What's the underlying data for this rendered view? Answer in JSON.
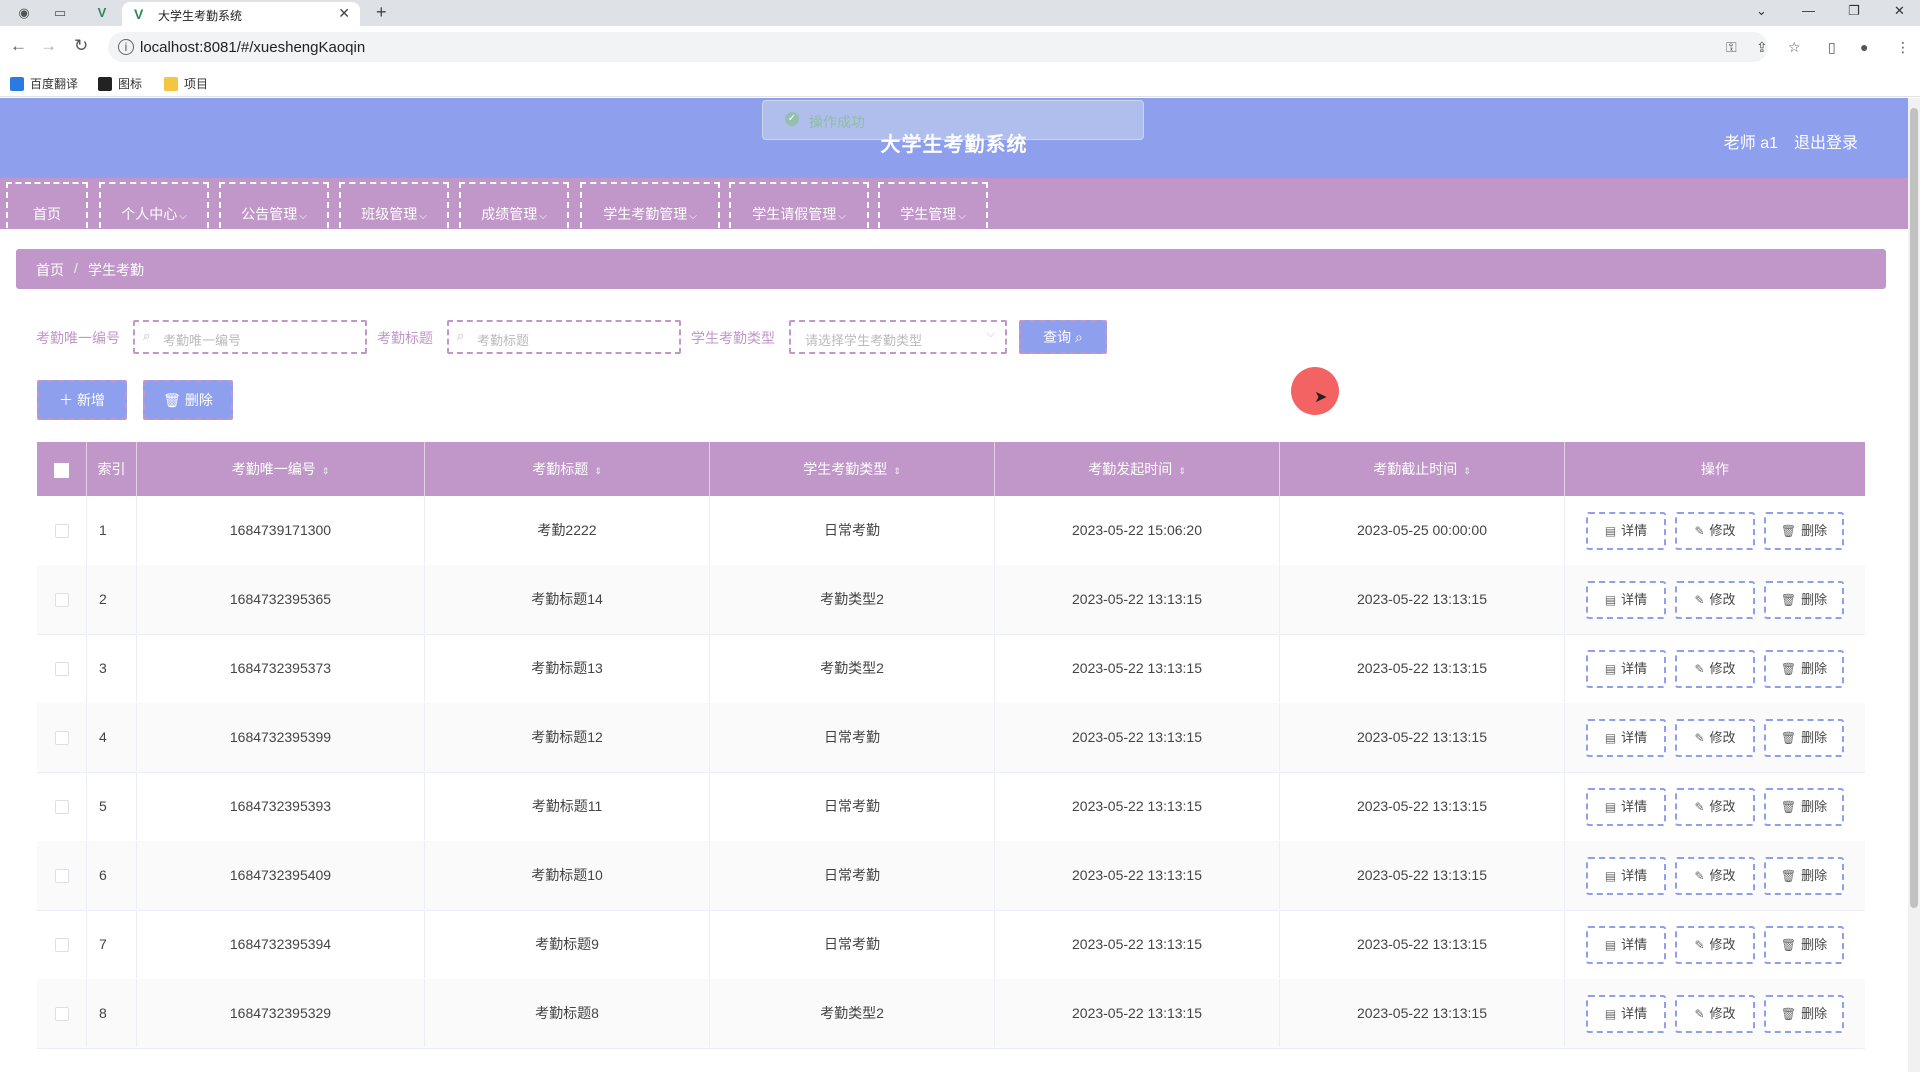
{
  "browser": {
    "tab_title": "大学生考勤系统",
    "url": "localhost:8081/#/xueshengKaoqin",
    "bookmarks": [
      "百度翻译",
      "图标",
      "项目"
    ]
  },
  "header": {
    "title": "大学生考勤系统",
    "user": "老师 a1",
    "logout": "退出登录",
    "toast": "操作成功"
  },
  "menu": [
    "首页",
    "个人中心",
    "公告管理",
    "班级管理",
    "成绩管理",
    "学生考勤管理",
    "学生请假管理",
    "学生管理"
  ],
  "breadcrumb": {
    "home": "首页",
    "sep": "/",
    "current": "学生考勤"
  },
  "search": {
    "id_label": "考勤唯一编号",
    "id_placeholder": "考勤唯一编号",
    "title_label": "考勤标题",
    "title_placeholder": "考勤标题",
    "type_label": "学生考勤类型",
    "type_placeholder": "请选择学生考勤类型",
    "query_button": "查询"
  },
  "actions": {
    "add": "新增",
    "delete": "删除"
  },
  "table": {
    "headers": [
      "索引",
      "考勤唯一编号",
      "考勤标题",
      "学生考勤类型",
      "考勤发起时间",
      "考勤截止时间",
      "操作"
    ],
    "op_labels": {
      "detail": "详情",
      "edit": "修改",
      "delete": "删除"
    },
    "rows": [
      {
        "index": "1",
        "id": "1684739171300",
        "title": "考勤2222",
        "type": "日常考勤",
        "start": "2023-05-22 15:06:20",
        "end": "2023-05-25 00:00:00"
      },
      {
        "index": "2",
        "id": "1684732395365",
        "title": "考勤标题14",
        "type": "考勤类型2",
        "start": "2023-05-22 13:13:15",
        "end": "2023-05-22 13:13:15"
      },
      {
        "index": "3",
        "id": "1684732395373",
        "title": "考勤标题13",
        "type": "考勤类型2",
        "start": "2023-05-22 13:13:15",
        "end": "2023-05-22 13:13:15"
      },
      {
        "index": "4",
        "id": "1684732395399",
        "title": "考勤标题12",
        "type": "日常考勤",
        "start": "2023-05-22 13:13:15",
        "end": "2023-05-22 13:13:15"
      },
      {
        "index": "5",
        "id": "1684732395393",
        "title": "考勤标题11",
        "type": "日常考勤",
        "start": "2023-05-22 13:13:15",
        "end": "2023-05-22 13:13:15"
      },
      {
        "index": "6",
        "id": "1684732395409",
        "title": "考勤标题10",
        "type": "日常考勤",
        "start": "2023-05-22 13:13:15",
        "end": "2023-05-22 13:13:15"
      },
      {
        "index": "7",
        "id": "1684732395394",
        "title": "考勤标题9",
        "type": "日常考勤",
        "start": "2023-05-22 13:13:15",
        "end": "2023-05-22 13:13:15"
      },
      {
        "index": "8",
        "id": "1684732395329",
        "title": "考勤标题8",
        "type": "考勤类型2",
        "start": "2023-05-22 13:13:15",
        "end": "2023-05-22 13:13:15"
      }
    ]
  },
  "colors": {
    "header": "#8e9fee",
    "menu": "#c197c9",
    "accent": "#8e9fee"
  }
}
